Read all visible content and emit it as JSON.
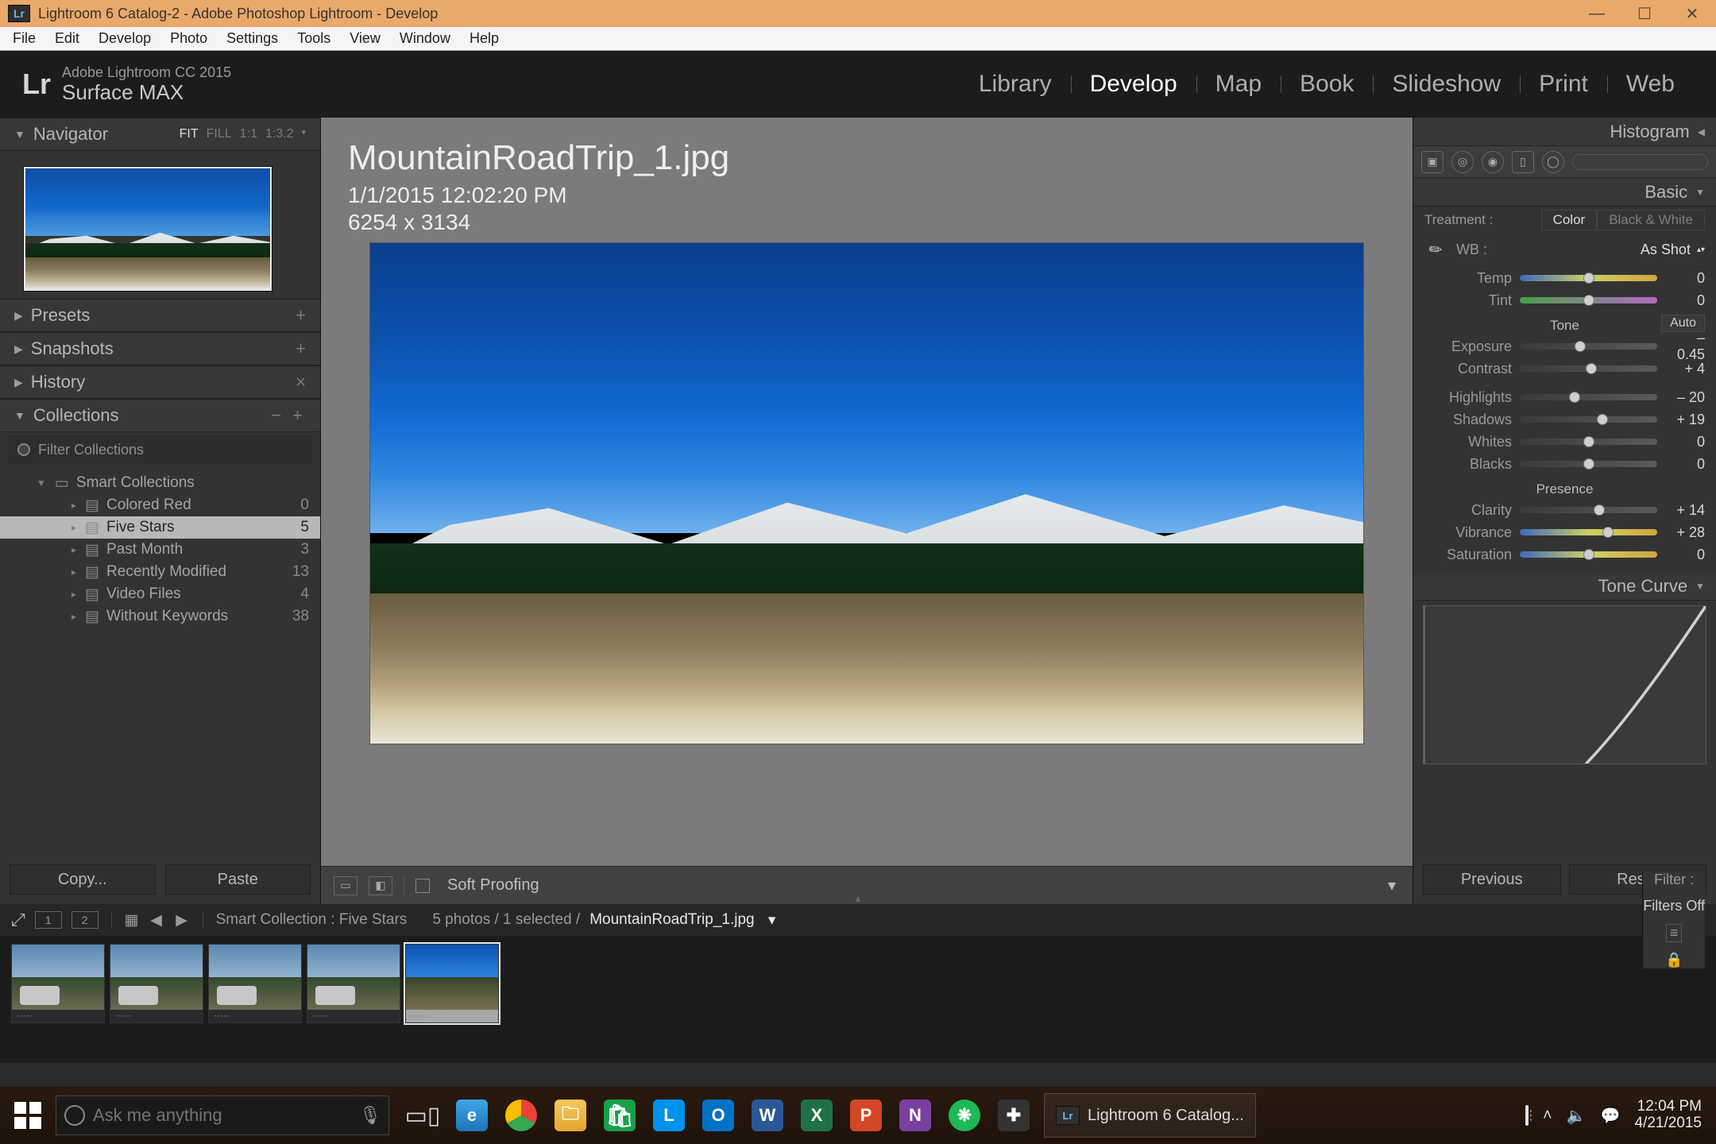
{
  "window": {
    "title": "Lightroom 6 Catalog-2 - Adobe Photoshop Lightroom - Develop"
  },
  "menus": [
    "File",
    "Edit",
    "Develop",
    "Photo",
    "Settings",
    "Tools",
    "View",
    "Window",
    "Help"
  ],
  "branding": {
    "line1": "Adobe Lightroom CC 2015",
    "line2": "Surface MAX"
  },
  "modules": {
    "items": [
      "Library",
      "Develop",
      "Map",
      "Book",
      "Slideshow",
      "Print",
      "Web"
    ],
    "active": "Develop"
  },
  "left": {
    "navigator": {
      "title": "Navigator",
      "opts": [
        "FIT",
        "FILL",
        "1:1",
        "1:3.2"
      ]
    },
    "sections": {
      "presets": "Presets",
      "snapshots": "Snapshots",
      "history": "History",
      "collections": "Collections"
    },
    "filter_label": "Filter Collections",
    "smart_header": "Smart Collections",
    "collections": [
      {
        "name": "Colored Red",
        "count": 0
      },
      {
        "name": "Five Stars",
        "count": 5,
        "selected": true
      },
      {
        "name": "Past Month",
        "count": 3
      },
      {
        "name": "Recently Modified",
        "count": 13
      },
      {
        "name": "Video Files",
        "count": 4
      },
      {
        "name": "Without Keywords",
        "count": 38
      }
    ],
    "copy": "Copy...",
    "paste": "Paste"
  },
  "image": {
    "file": "MountainRoadTrip_1.jpg",
    "datetime": "1/1/2015 12:02:20 PM",
    "dims": "6254 x 3134"
  },
  "center_toolbar": {
    "soft_proof": "Soft Proofing"
  },
  "right": {
    "histogram": "Histogram",
    "basic": "Basic",
    "treatment_label": "Treatment :",
    "treatment": {
      "color": "Color",
      "bw": "Black & White"
    },
    "wb_label": "WB :",
    "wb_value": "As Shot",
    "groups": {
      "tone": "Tone",
      "auto": "Auto",
      "presence": "Presence"
    },
    "sliders": {
      "temp": {
        "name": "Temp",
        "value": 0,
        "pos": 50
      },
      "tint": {
        "name": "Tint",
        "value": 0,
        "pos": 50
      },
      "exposure": {
        "name": "Exposure",
        "value": "– 0.45",
        "pos": 44
      },
      "contrast": {
        "name": "Contrast",
        "value": "+ 4",
        "pos": 52
      },
      "highlights": {
        "name": "Highlights",
        "value": "– 20",
        "pos": 40
      },
      "shadows": {
        "name": "Shadows",
        "value": "+ 19",
        "pos": 60
      },
      "whites": {
        "name": "Whites",
        "value": 0,
        "pos": 50
      },
      "blacks": {
        "name": "Blacks",
        "value": 0,
        "pos": 50
      },
      "clarity": {
        "name": "Clarity",
        "value": "+ 14",
        "pos": 58
      },
      "vibrance": {
        "name": "Vibrance",
        "value": "+ 28",
        "pos": 64
      },
      "saturation": {
        "name": "Saturation",
        "value": 0,
        "pos": 50
      }
    },
    "tonecurve": "Tone Curve",
    "previous": "Previous",
    "reset": "Reset"
  },
  "lowbar": {
    "path1": "Smart Collection : Five Stars",
    "path2": "5 photos / 1 selected /",
    "file": "MountainRoadTrip_1.jpg",
    "filter_label": "Filter :",
    "filter_value": "Filters Off"
  },
  "taskbar": {
    "search_placeholder": "Ask me anything",
    "app_label": "Lightroom 6 Catalog...",
    "time": "12:04 PM",
    "date": "4/21/2015"
  }
}
